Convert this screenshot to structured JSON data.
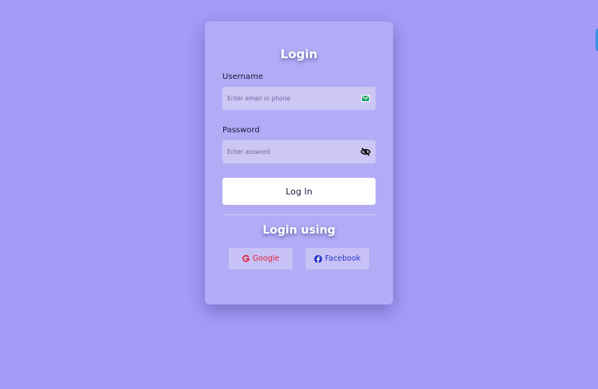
{
  "login_card": {
    "title": "Login",
    "username": {
      "label": "Username",
      "placeholder": "Enter email or phone",
      "value": "",
      "icon": "mail-icon"
    },
    "password": {
      "label": "Password",
      "placeholder": "Enter assword",
      "value": "",
      "icon": "eye-off-icon"
    },
    "submit_label": "Log In",
    "social_heading": "Login using",
    "social": [
      {
        "label": "Google",
        "icon": "google-icon",
        "color": "#e0263a"
      },
      {
        "label": "Facebook",
        "icon": "facebook-icon",
        "color": "#2d36c9"
      }
    ]
  },
  "colors": {
    "background": "#a39bf7",
    "card": "#b2acf7",
    "input": "#cdc7f6",
    "social_button": "#c7c1f5"
  }
}
